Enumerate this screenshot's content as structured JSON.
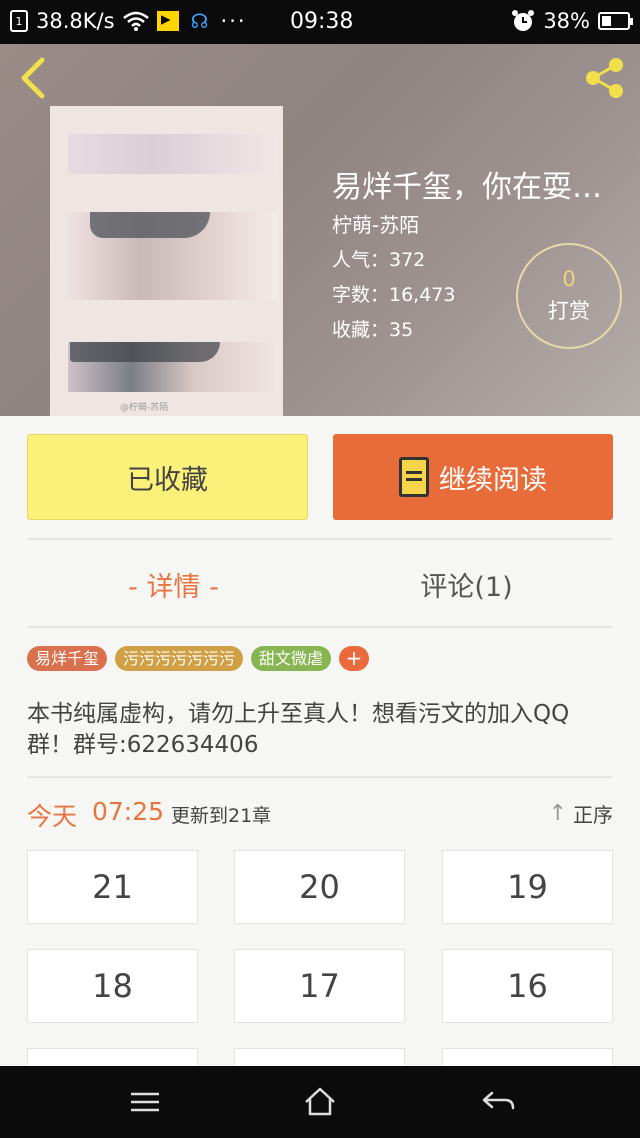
{
  "status_bar": {
    "sim": "1",
    "speed": "38.8K/s",
    "dots": "···",
    "time": "09:38",
    "battery": "38%"
  },
  "book": {
    "title": "易烊千玺，你在耍…",
    "author": "柠萌-苏陌",
    "popularity": "人气：372",
    "word_count": "字数：16,473",
    "favorites": "收藏：35",
    "cover_watermark": "@柠萌-苏陌"
  },
  "reward": {
    "count": "0",
    "label": "打赏"
  },
  "actions": {
    "favorited_label": "已收藏",
    "continue_label": "继续阅读"
  },
  "tabs": {
    "detail": "- 详情 -",
    "comments": "评论(1)"
  },
  "tags": [
    {
      "label": "易烊千玺",
      "color": "#d9704e"
    },
    {
      "label": "污污污污污污污",
      "color": "#d2a044"
    },
    {
      "label": "甜文微虐",
      "color": "#86b551"
    }
  ],
  "tag_add": "+",
  "description": "本书纯属虚构，请勿上升至真人！想看污文的加入QQ群！群号:622634406",
  "update": {
    "today": "今天",
    "time": "07:25",
    "chapter_text": "更新到21章",
    "sort_label": "正序"
  },
  "chapters": [
    "21",
    "20",
    "19",
    "18",
    "17",
    "16"
  ],
  "colors": {
    "accent": "#e8743f",
    "favorite_button": "#fbf07a",
    "read_button": "#e86b3a"
  }
}
